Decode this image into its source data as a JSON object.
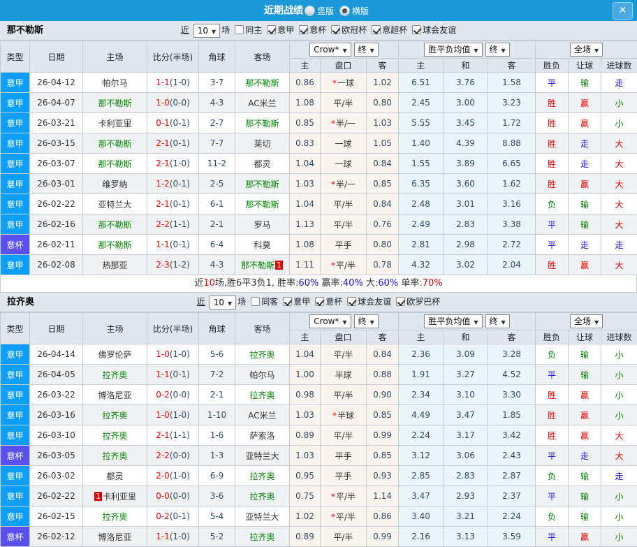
{
  "titlebar": {
    "title": "近期战绩",
    "view_options": [
      {
        "label": "竖版",
        "checked": false
      },
      {
        "label": "横版",
        "checked": true
      }
    ],
    "close_glyph": "✕"
  },
  "colors": {
    "titlebar_bg": "#1b98d8",
    "league_badge": {
      "意甲": "#0d9ff7",
      "意杯": "#5a50f0"
    },
    "team_green": "#008800",
    "score_red": "#ff0000",
    "value_blue": "#1414dc",
    "result": {
      "胜": "#e60000",
      "平": "#1414dc",
      "负": "#008000",
      "赢": "#e60000",
      "输": "#008000",
      "走": "#1414dc",
      "大": "#e60000",
      "小": "#008000"
    }
  },
  "table": {
    "base_cols": [
      "类型",
      "日期",
      "主场",
      "比分(半场)",
      "角球",
      "客场"
    ],
    "odds_select": "Crow*",
    "final_select": "终",
    "avg_select": "胜平负均值",
    "full_select": "全场",
    "sub_cols": [
      "主",
      "盘口",
      "客",
      "主",
      "和",
      "客",
      "胜负",
      "让球",
      "进球数"
    ]
  },
  "sections": [
    {
      "team": "那不勒斯",
      "filter": {
        "near": "近",
        "count": "10",
        "unit": "场",
        "main": {
          "label": "同主",
          "checked": false
        },
        "comps": [
          {
            "label": "意甲",
            "checked": true
          },
          {
            "label": "意杯",
            "checked": true
          },
          {
            "label": "欧冠杯",
            "checked": true
          },
          {
            "label": "意超杯",
            "checked": true
          },
          {
            "label": "球会友谊",
            "checked": true
          }
        ]
      },
      "rows": [
        {
          "c": "意甲",
          "d": "26-04-12",
          "h": "帕尔马",
          "hg": false,
          "hc": "",
          "s": "1-1",
          "half": "(1-0)",
          "cn": "3-7",
          "a": "那不勒斯",
          "ag": true,
          "ac": "",
          "o1": "0.86",
          "st": true,
          "hd": "一球",
          "o2": "1.02",
          "avg": [
            "6.51",
            "3.76",
            "1.58"
          ],
          "res": [
            "平",
            "输",
            "走"
          ]
        },
        {
          "c": "意甲",
          "d": "26-04-07",
          "h": "那不勒斯",
          "hg": true,
          "hc": "",
          "s": "1-0",
          "half": "(0-0)",
          "cn": "4-3",
          "a": "AC米兰",
          "ag": false,
          "ac": "",
          "o1": "1.08",
          "st": false,
          "hd": "平/半",
          "o2": "0.80",
          "avg": [
            "2.45",
            "3.00",
            "3.23"
          ],
          "res": [
            "胜",
            "赢",
            "小"
          ]
        },
        {
          "c": "意甲",
          "d": "26-03-21",
          "h": "卡利亚里",
          "hg": false,
          "hc": "",
          "s": "0-1",
          "half": "(0-1)",
          "cn": "2-7",
          "a": "那不勒斯",
          "ag": true,
          "ac": "",
          "o1": "0.85",
          "st": true,
          "hd": "半/一",
          "o2": "1.03",
          "avg": [
            "5.55",
            "3.45",
            "1.72"
          ],
          "res": [
            "胜",
            "赢",
            "小"
          ]
        },
        {
          "c": "意甲",
          "d": "26-03-15",
          "h": "那不勒斯",
          "hg": true,
          "hc": "",
          "s": "2-1",
          "half": "(0-1)",
          "cn": "7-7",
          "a": "莱切",
          "ag": false,
          "ac": "",
          "o1": "0.83",
          "st": false,
          "hd": "一球",
          "o2": "1.05",
          "avg": [
            "1.40",
            "4.39",
            "8.88"
          ],
          "res": [
            "胜",
            "走",
            "大"
          ]
        },
        {
          "c": "意甲",
          "d": "26-03-07",
          "h": "那不勒斯",
          "hg": true,
          "hc": "",
          "s": "2-1",
          "half": "(1-0)",
          "cn": "11-2",
          "a": "都灵",
          "ag": false,
          "ac": "",
          "o1": "1.04",
          "st": false,
          "hd": "一球",
          "o2": "0.84",
          "avg": [
            "1.55",
            "3.89",
            "6.65"
          ],
          "res": [
            "胜",
            "走",
            "大"
          ]
        },
        {
          "c": "意甲",
          "d": "26-03-01",
          "h": "维罗纳",
          "hg": false,
          "hc": "",
          "s": "1-2",
          "half": "(0-1)",
          "cn": "2-5",
          "a": "那不勒斯",
          "ag": true,
          "ac": "",
          "o1": "1.03",
          "st": true,
          "hd": "半/一",
          "o2": "0.85",
          "avg": [
            "6.35",
            "3.60",
            "1.62"
          ],
          "res": [
            "胜",
            "赢",
            "大"
          ]
        },
        {
          "c": "意甲",
          "d": "26-02-22",
          "h": "亚特兰大",
          "hg": false,
          "hc": "",
          "s": "2-1",
          "half": "(0-1)",
          "cn": "6-1",
          "a": "那不勒斯",
          "ag": true,
          "ac": "",
          "o1": "1.04",
          "st": false,
          "hd": "平/半",
          "o2": "0.84",
          "avg": [
            "2.48",
            "3.01",
            "3.16"
          ],
          "res": [
            "负",
            "输",
            "大"
          ]
        },
        {
          "c": "意甲",
          "d": "26-02-16",
          "h": "那不勒斯",
          "hg": true,
          "hc": "",
          "s": "2-2",
          "half": "(1-1)",
          "cn": "2-1",
          "a": "罗马",
          "ag": false,
          "ac": "",
          "o1": "1.13",
          "st": false,
          "hd": "平/半",
          "o2": "0.76",
          "avg": [
            "2.49",
            "2.83",
            "3.38"
          ],
          "res": [
            "平",
            "输",
            "大"
          ]
        },
        {
          "c": "意杯",
          "d": "26-02-11",
          "h": "那不勒斯",
          "hg": true,
          "hc": "",
          "s": "1-1",
          "half": "(0-1)",
          "cn": "6-4",
          "a": "科莫",
          "ag": false,
          "ac": "",
          "o1": "1.08",
          "st": false,
          "hd": "平手",
          "o2": "0.80",
          "avg": [
            "2.81",
            "2.98",
            "2.72"
          ],
          "res": [
            "平",
            "走",
            "走"
          ]
        },
        {
          "c": "意甲",
          "d": "26-02-08",
          "h": "热那亚",
          "hg": false,
          "hc": "",
          "s": "2-3",
          "half": "(1-2)",
          "cn": "4-3",
          "a": "那不勒斯",
          "ag": true,
          "ac": "1",
          "o1": "1.11",
          "st": true,
          "hd": "平/半",
          "o2": "0.78",
          "avg": [
            "4.32",
            "3.02",
            "2.04"
          ],
          "res": [
            "胜",
            "赢",
            "大"
          ]
        }
      ],
      "summary": [
        {
          "t": "近",
          "c": "#333333"
        },
        {
          "t": "10",
          "c": "#e60000"
        },
        {
          "t": "场,胜6平3负1, 胜率:",
          "c": "#333333"
        },
        {
          "t": "60%",
          "c": "#1414dc"
        },
        {
          "t": " 赢率:",
          "c": "#333333"
        },
        {
          "t": "40%",
          "c": "#1414dc"
        },
        {
          "t": " 大:",
          "c": "#333333"
        },
        {
          "t": "60%",
          "c": "#1414dc"
        },
        {
          "t": " 单率:",
          "c": "#333333"
        },
        {
          "t": "70%",
          "c": "#e60000"
        }
      ]
    },
    {
      "team": "拉齐奥",
      "filter": {
        "near": "近",
        "count": "10",
        "unit": "场",
        "main": {
          "label": "同客",
          "checked": false
        },
        "comps": [
          {
            "label": "意甲",
            "checked": true
          },
          {
            "label": "意杯",
            "checked": true
          },
          {
            "label": "球会友谊",
            "checked": true
          },
          {
            "label": "欧罗巴杯",
            "checked": true
          }
        ]
      },
      "rows": [
        {
          "c": "意甲",
          "d": "26-04-14",
          "h": "佛罗伦萨",
          "hg": false,
          "hc": "",
          "s": "1-0",
          "half": "(1-0)",
          "cn": "5-6",
          "a": "拉齐奥",
          "ag": true,
          "ac": "",
          "o1": "1.04",
          "st": false,
          "hd": "平/半",
          "o2": "0.84",
          "avg": [
            "2.36",
            "3.09",
            "3.28"
          ],
          "res": [
            "负",
            "输",
            "小"
          ]
        },
        {
          "c": "意甲",
          "d": "26-04-05",
          "h": "拉齐奥",
          "hg": true,
          "hc": "",
          "s": "1-1",
          "half": "(0-1)",
          "cn": "7-2",
          "a": "帕尔马",
          "ag": false,
          "ac": "",
          "o1": "1.00",
          "st": false,
          "hd": "半球",
          "o2": "0.88",
          "avg": [
            "1.91",
            "3.27",
            "4.52"
          ],
          "res": [
            "平",
            "输",
            "小"
          ]
        },
        {
          "c": "意甲",
          "d": "26-03-22",
          "h": "博洛尼亚",
          "hg": false,
          "hc": "",
          "s": "0-2",
          "half": "(0-0)",
          "cn": "2-1",
          "a": "拉齐奥",
          "ag": true,
          "ac": "",
          "o1": "0.98",
          "st": false,
          "hd": "平/半",
          "o2": "0.90",
          "avg": [
            "2.34",
            "3.10",
            "3.30"
          ],
          "res": [
            "胜",
            "赢",
            "小"
          ]
        },
        {
          "c": "意甲",
          "d": "26-03-16",
          "h": "拉齐奥",
          "hg": true,
          "hc": "",
          "s": "1-0",
          "half": "(1-0)",
          "cn": "1-10",
          "a": "AC米兰",
          "ag": false,
          "ac": "",
          "o1": "1.03",
          "st": true,
          "hd": "半球",
          "o2": "0.85",
          "avg": [
            "4.49",
            "3.47",
            "1.85"
          ],
          "res": [
            "胜",
            "赢",
            "小"
          ]
        },
        {
          "c": "意甲",
          "d": "26-03-10",
          "h": "拉齐奥",
          "hg": true,
          "hc": "",
          "s": "2-1",
          "half": "(1-1)",
          "cn": "1-6",
          "a": "萨索洛",
          "ag": false,
          "ac": "",
          "o1": "0.89",
          "st": false,
          "hd": "平/半",
          "o2": "0.99",
          "avg": [
            "2.24",
            "3.17",
            "3.42"
          ],
          "res": [
            "胜",
            "赢",
            "大"
          ]
        },
        {
          "c": "意杯",
          "d": "26-03-05",
          "h": "拉齐奥",
          "hg": true,
          "hc": "",
          "s": "2-2",
          "half": "(0-0)",
          "cn": "1-3",
          "a": "亚特兰大",
          "ag": false,
          "ac": "",
          "o1": "1.03",
          "st": false,
          "hd": "平手",
          "o2": "0.85",
          "avg": [
            "3.12",
            "3.06",
            "2.43"
          ],
          "res": [
            "平",
            "走",
            "大"
          ]
        },
        {
          "c": "意甲",
          "d": "26-03-02",
          "h": "都灵",
          "hg": false,
          "hc": "",
          "s": "2-0",
          "half": "(1-0)",
          "cn": "6-9",
          "a": "拉齐奥",
          "ag": true,
          "ac": "",
          "o1": "0.95",
          "st": false,
          "hd": "平手",
          "o2": "0.93",
          "avg": [
            "2.85",
            "2.83",
            "2.87"
          ],
          "res": [
            "负",
            "输",
            "走"
          ]
        },
        {
          "c": "意甲",
          "d": "26-02-22",
          "h": "卡利亚里",
          "hg": false,
          "hc": "1",
          "s": "0-0",
          "half": "(0-0)",
          "cn": "3-6",
          "a": "拉齐奥",
          "ag": true,
          "ac": "",
          "o1": "0.75",
          "st": true,
          "hd": "平/半",
          "o2": "1.14",
          "avg": [
            "3.47",
            "2.93",
            "2.37"
          ],
          "res": [
            "平",
            "输",
            "小"
          ]
        },
        {
          "c": "意甲",
          "d": "26-02-15",
          "h": "拉齐奥",
          "hg": true,
          "hc": "",
          "s": "0-2",
          "half": "(0-1)",
          "cn": "5-4",
          "a": "亚特兰大",
          "ag": false,
          "ac": "",
          "o1": "1.02",
          "st": true,
          "hd": "平/半",
          "o2": "0.86",
          "avg": [
            "3.40",
            "3.21",
            "2.24"
          ],
          "res": [
            "负",
            "输",
            "小"
          ]
        },
        {
          "c": "意杯",
          "d": "26-02-12",
          "h": "博洛尼亚",
          "hg": false,
          "hc": "",
          "s": "1-1",
          "half": "(1-0)",
          "cn": "5-2",
          "a": "拉齐奥",
          "ag": true,
          "ac": "",
          "o1": "0.89",
          "st": false,
          "hd": "平/半",
          "o2": "0.99",
          "avg": [
            "2.16",
            "3.13",
            "3.59"
          ],
          "res": [
            "平",
            "赢",
            "小"
          ]
        }
      ],
      "summary": null
    }
  ]
}
